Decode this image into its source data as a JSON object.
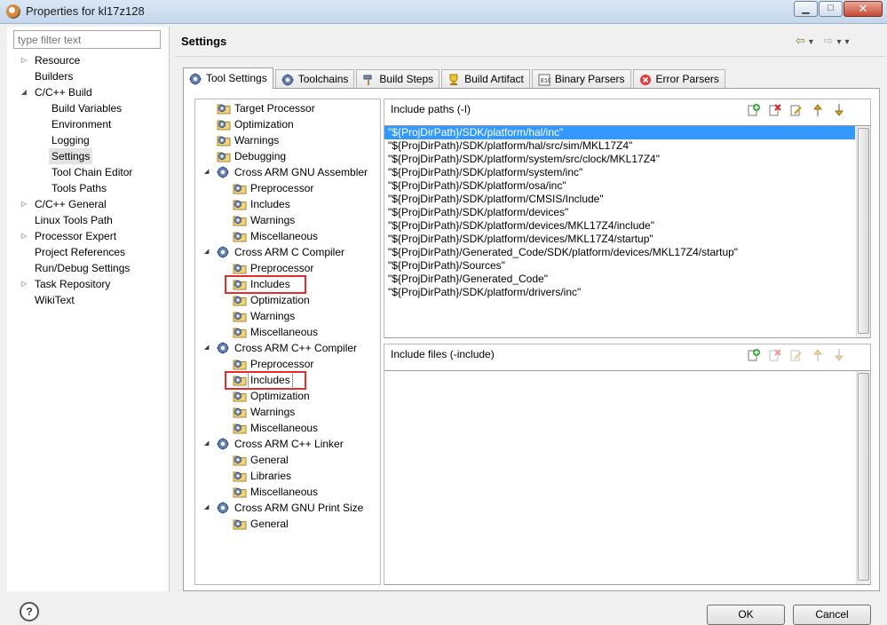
{
  "window": {
    "title": "Properties for kl17z128",
    "minimize": "▁",
    "maximize": "□",
    "close": "✕"
  },
  "filter": {
    "placeholder": "type filter text"
  },
  "nav": [
    {
      "label": "Resource",
      "indent": 0,
      "expander": "▷"
    },
    {
      "label": "Builders",
      "indent": 0,
      "expander": ""
    },
    {
      "label": "C/C++ Build",
      "indent": 0,
      "expander": "◢"
    },
    {
      "label": "Build Variables",
      "indent": 1,
      "expander": ""
    },
    {
      "label": "Environment",
      "indent": 1,
      "expander": ""
    },
    {
      "label": "Logging",
      "indent": 1,
      "expander": ""
    },
    {
      "label": "Settings",
      "indent": 1,
      "expander": "",
      "selected": true
    },
    {
      "label": "Tool Chain Editor",
      "indent": 1,
      "expander": ""
    },
    {
      "label": "Tools Paths",
      "indent": 1,
      "expander": ""
    },
    {
      "label": "C/C++ General",
      "indent": 0,
      "expander": "▷"
    },
    {
      "label": "Linux Tools Path",
      "indent": 0,
      "expander": ""
    },
    {
      "label": "Processor Expert",
      "indent": 0,
      "expander": "▷"
    },
    {
      "label": "Project References",
      "indent": 0,
      "expander": ""
    },
    {
      "label": "Run/Debug Settings",
      "indent": 0,
      "expander": ""
    },
    {
      "label": "Task Repository",
      "indent": 0,
      "expander": "▷"
    },
    {
      "label": "WikiText",
      "indent": 0,
      "expander": ""
    }
  ],
  "page": {
    "title": "Settings",
    "back_arrow": "⇦",
    "forward_arrow": "⇨",
    "menu": "▾"
  },
  "tabs": [
    {
      "label": "Tool Settings",
      "icon": "gears-icon",
      "active": true
    },
    {
      "label": "Toolchains",
      "icon": "gears-icon"
    },
    {
      "label": "Build Steps",
      "icon": "hammer-icon"
    },
    {
      "label": "Build Artifact",
      "icon": "trophy-icon"
    },
    {
      "label": "Binary Parsers",
      "icon": "binary-icon"
    },
    {
      "label": "Error Parsers",
      "icon": "error-icon"
    }
  ],
  "tree": [
    {
      "label": "Target Processor",
      "level": 0,
      "icon": "folder-gear-icon"
    },
    {
      "label": "Optimization",
      "level": 0,
      "icon": "folder-gear-icon"
    },
    {
      "label": "Warnings",
      "level": 0,
      "icon": "folder-gear-icon"
    },
    {
      "label": "Debugging",
      "level": 0,
      "icon": "folder-gear-icon"
    },
    {
      "label": "Cross ARM GNU Assembler",
      "level": 0,
      "icon": "gears-icon",
      "expander": "◢"
    },
    {
      "label": "Preprocessor",
      "level": 1,
      "icon": "folder-gear-icon"
    },
    {
      "label": "Includes",
      "level": 1,
      "icon": "folder-gear-icon"
    },
    {
      "label": "Warnings",
      "level": 1,
      "icon": "folder-gear-icon"
    },
    {
      "label": "Miscellaneous",
      "level": 1,
      "icon": "folder-gear-icon"
    },
    {
      "label": "Cross ARM C Compiler",
      "level": 0,
      "icon": "gears-icon",
      "expander": "◢"
    },
    {
      "label": "Preprocessor",
      "level": 1,
      "icon": "folder-gear-icon"
    },
    {
      "label": "Includes",
      "level": 1,
      "icon": "folder-gear-icon",
      "highlight": true
    },
    {
      "label": "Optimization",
      "level": 1,
      "icon": "folder-gear-icon"
    },
    {
      "label": "Warnings",
      "level": 1,
      "icon": "folder-gear-icon"
    },
    {
      "label": "Miscellaneous",
      "level": 1,
      "icon": "folder-gear-icon"
    },
    {
      "label": "Cross ARM C++ Compiler",
      "level": 0,
      "icon": "gears-icon",
      "expander": "◢"
    },
    {
      "label": "Preprocessor",
      "level": 1,
      "icon": "folder-gear-icon"
    },
    {
      "label": "Includes",
      "level": 1,
      "icon": "folder-gear-icon",
      "highlight": true,
      "focused": true
    },
    {
      "label": "Optimization",
      "level": 1,
      "icon": "folder-gear-icon"
    },
    {
      "label": "Warnings",
      "level": 1,
      "icon": "folder-gear-icon"
    },
    {
      "label": "Miscellaneous",
      "level": 1,
      "icon": "folder-gear-icon"
    },
    {
      "label": "Cross ARM C++ Linker",
      "level": 0,
      "icon": "gears-icon",
      "expander": "◢"
    },
    {
      "label": "General",
      "level": 1,
      "icon": "folder-gear-icon"
    },
    {
      "label": "Libraries",
      "level": 1,
      "icon": "folder-gear-icon"
    },
    {
      "label": "Miscellaneous",
      "level": 1,
      "icon": "folder-gear-icon"
    },
    {
      "label": "Cross ARM GNU Print Size",
      "level": 0,
      "icon": "gears-icon",
      "expander": "◢"
    },
    {
      "label": "General",
      "level": 1,
      "icon": "folder-gear-icon"
    }
  ],
  "include_paths": {
    "header": "Include paths (-I)",
    "items": [
      "\"${ProjDirPath}/SDK/platform/hal/inc\"",
      "\"${ProjDirPath}/SDK/platform/hal/src/sim/MKL17Z4\"",
      "\"${ProjDirPath}/SDK/platform/system/src/clock/MKL17Z4\"",
      "\"${ProjDirPath}/SDK/platform/system/inc\"",
      "\"${ProjDirPath}/SDK/platform/osa/inc\"",
      "\"${ProjDirPath}/SDK/platform/CMSIS/Include\"",
      "\"${ProjDirPath}/SDK/platform/devices\"",
      "\"${ProjDirPath}/SDK/platform/devices/MKL17Z4/include\"",
      "\"${ProjDirPath}/SDK/platform/devices/MKL17Z4/startup\"",
      "\"${ProjDirPath}/Generated_Code/SDK/platform/devices/MKL17Z4/startup\"",
      "\"${ProjDirPath}/Sources\"",
      "\"${ProjDirPath}/Generated_Code\"",
      "\"${ProjDirPath}/SDK/platform/drivers/inc\""
    ],
    "selected_index": 0
  },
  "include_files": {
    "header": "Include files (-include)",
    "items": []
  },
  "list_tools": [
    "add-icon",
    "delete-icon",
    "edit-icon",
    "move-up-icon",
    "move-down-icon"
  ],
  "buttons": {
    "help": "?",
    "ok": "OK",
    "cancel": "Cancel"
  },
  "colors": {
    "selection": "#3399ff",
    "highlight_box": "#e52c2c"
  }
}
